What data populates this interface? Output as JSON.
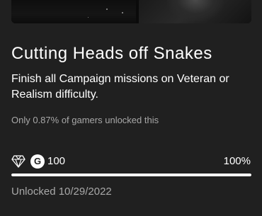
{
  "achievement": {
    "title": "Cutting Heads off Snakes",
    "description": "Finish all Campaign missions on Veteran or Realism difficulty.",
    "rarity_text": "Only 0.87% of gamers unlocked this",
    "gamerscore_badge": "G",
    "gamerscore": "100",
    "progress_label": "100%",
    "progress_percent": 100,
    "unlocked_text": "Unlocked 10/29/2022",
    "icons": {
      "rarity": "diamond-icon",
      "gamerscore": "gamerscore-icon"
    }
  },
  "colors": {
    "background": "#202020",
    "text_primary": "#ffffff",
    "text_secondary": "#a8a8a8",
    "progress_track": "#3c3c3c",
    "progress_fill": "#ffffff"
  }
}
